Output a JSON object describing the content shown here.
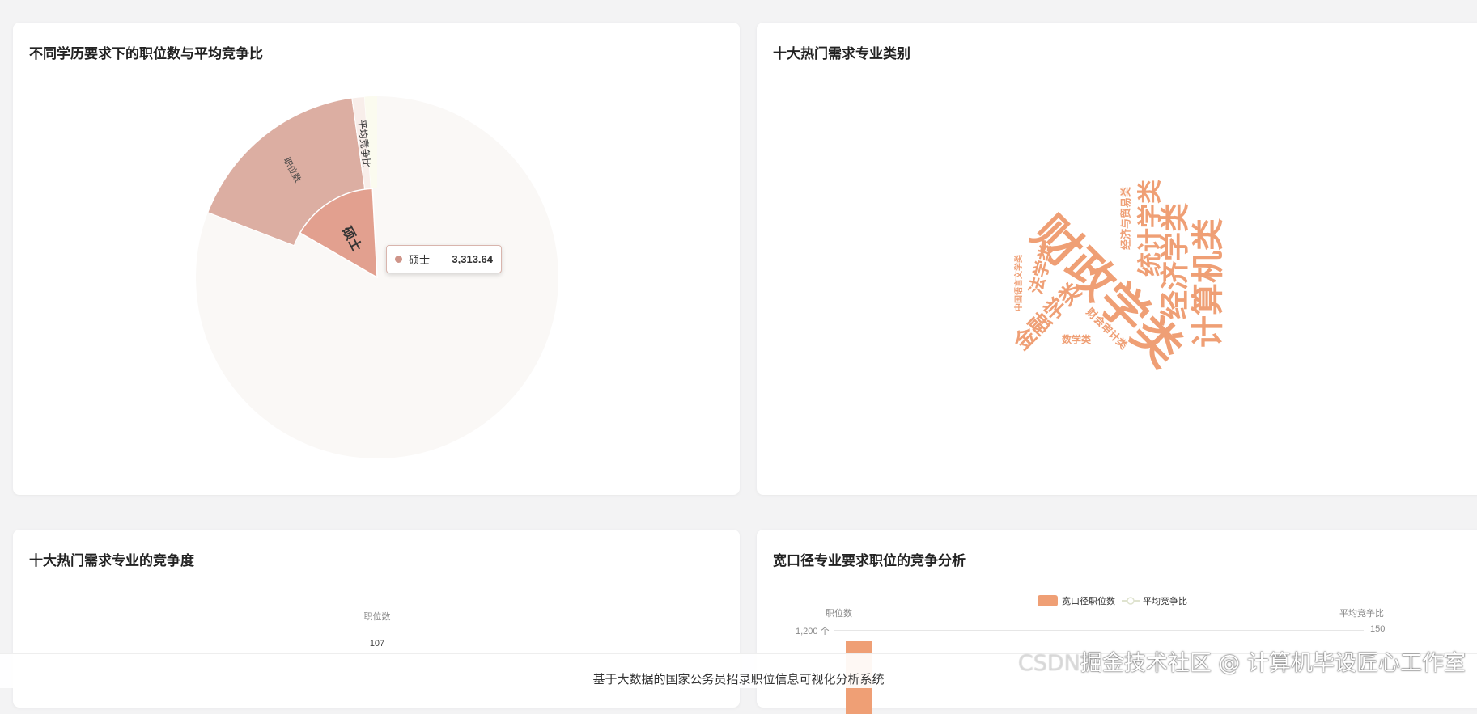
{
  "cards": {
    "education": {
      "title": "不同学历要求下的职位数与平均竞争比",
      "labels": {
        "outer": "职位数",
        "thin": "平均竞争比",
        "inner": "硕士"
      },
      "tooltip": {
        "name": "硕士",
        "value": "3,313.64"
      }
    },
    "majors": {
      "title": "十大热门需求专业类别",
      "words": [
        "财政学类",
        "计算机类",
        "经济学类",
        "统计学类",
        "经济与贸易类",
        "法学类",
        "中国语言文学类",
        "金融学类",
        "财会审计类",
        "数学类"
      ]
    },
    "competition": {
      "title": "十大热门需求专业的竞争度",
      "axis_name": "职位数",
      "value_label": "107"
    },
    "broad": {
      "title": "宽口径专业要求职位的竞争分析",
      "legend": [
        "宽口径职位数",
        "平均竞争比"
      ],
      "left_axis_name": "职位数",
      "right_axis_name": "平均竞争比",
      "left_tick": "1,200 个",
      "right_tick": "150"
    }
  },
  "footer": {
    "text": "基于大数据的国家公务员招录职位信息可视化分析系统"
  },
  "watermark": {
    "prefix": "CSDN",
    "text": "掘金技术社区 @ 计算机毕设匠心工作室"
  },
  "colors": {
    "word": "#ef9f75",
    "outer": "#dcaea2",
    "inner": "#e2a08f",
    "faded": "#faf8f6",
    "bar": "#ef9f75"
  }
}
